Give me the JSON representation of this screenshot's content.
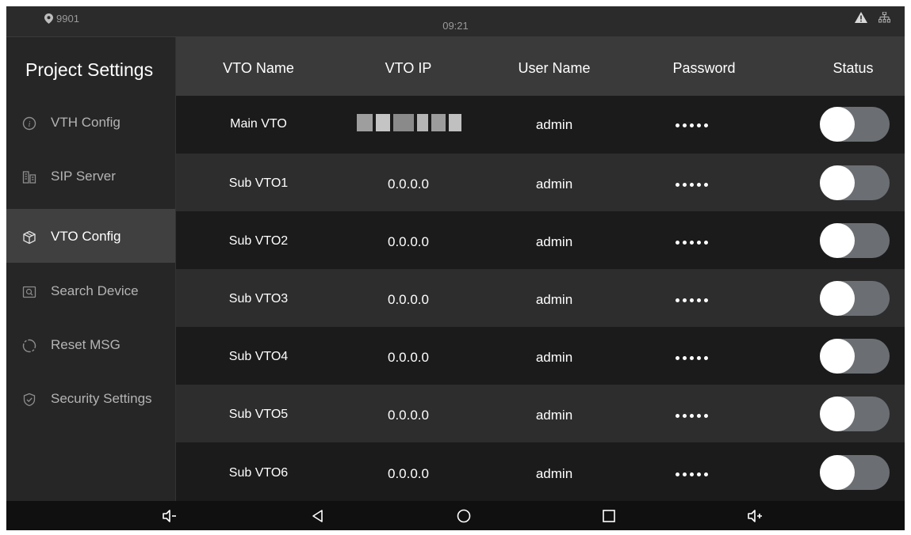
{
  "status_bar": {
    "location": "9901",
    "time": "09:21",
    "icons": [
      "location-pin-icon",
      "alert-icon",
      "network-icon"
    ]
  },
  "sidebar": {
    "title": "Project Settings",
    "items": [
      {
        "label": "VTH Config",
        "icon": "info-icon",
        "active": false
      },
      {
        "label": "SIP Server",
        "icon": "server-icon",
        "active": false
      },
      {
        "label": "VTO Config",
        "icon": "cube-icon",
        "active": true
      },
      {
        "label": "Search Device",
        "icon": "search-device-icon",
        "active": false
      },
      {
        "label": "Reset MSG",
        "icon": "reset-icon",
        "active": false
      },
      {
        "label": "Security Settings",
        "icon": "shield-icon",
        "active": false
      }
    ]
  },
  "table": {
    "columns": [
      "VTO Name",
      "VTO IP",
      "User Name",
      "Password",
      "Status"
    ],
    "rows": [
      {
        "name": "Main VTO",
        "ip": "",
        "user": "admin",
        "password_mask": "•••••",
        "enabled": false
      },
      {
        "name": "Sub VTO1",
        "ip": "0.0.0.0",
        "user": "admin",
        "password_mask": "•••••",
        "enabled": false
      },
      {
        "name": "Sub VTO2",
        "ip": "0.0.0.0",
        "user": "admin",
        "password_mask": "•••••",
        "enabled": false
      },
      {
        "name": "Sub VTO3",
        "ip": "0.0.0.0",
        "user": "admin",
        "password_mask": "•••••",
        "enabled": false
      },
      {
        "name": "Sub VTO4",
        "ip": "0.0.0.0",
        "user": "admin",
        "password_mask": "•••••",
        "enabled": false
      },
      {
        "name": "Sub VTO5",
        "ip": "0.0.0.0",
        "user": "admin",
        "password_mask": "•••••",
        "enabled": false
      },
      {
        "name": "Sub VTO6",
        "ip": "0.0.0.0",
        "user": "admin",
        "password_mask": "•••••",
        "enabled": false
      }
    ]
  },
  "nav_bar": {
    "buttons": [
      "volume-down-icon",
      "back-icon",
      "home-icon",
      "recents-icon",
      "volume-up-icon"
    ]
  },
  "colors": {
    "background": "#1b1b1b",
    "header": "#3a3a3a",
    "sidebar": "#262626",
    "active_item": "#404040",
    "toggle_off": "#6b6f73"
  }
}
